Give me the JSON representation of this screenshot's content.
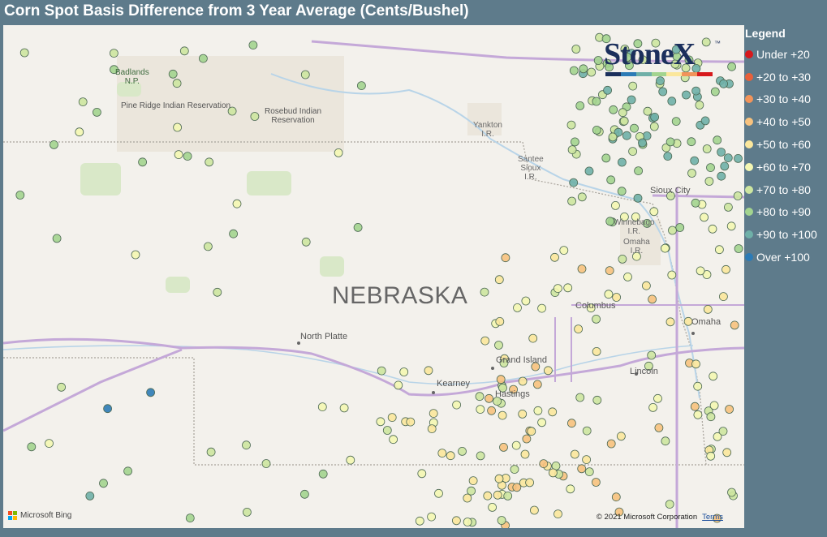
{
  "title": "Corn Spot Basis Difference from 3 Year Average (Cents/Bushel)",
  "legend": {
    "title": "Legend",
    "items": [
      {
        "label": "Under +20",
        "color": "#d7191c"
      },
      {
        "label": "+20 to +30",
        "color": "#e8603a"
      },
      {
        "label": "+30 to +40",
        "color": "#f2945a"
      },
      {
        "label": "+40 to +50",
        "color": "#f7c27e"
      },
      {
        "label": "+50 to +60",
        "color": "#fbe79c"
      },
      {
        "label": "+60 to +70",
        "color": "#f4f7b3"
      },
      {
        "label": "+70 to +80",
        "color": "#cde6a0"
      },
      {
        "label": "+80 to +90",
        "color": "#a3d48f"
      },
      {
        "label": "+90 to +100",
        "color": "#6fb0a8"
      },
      {
        "label": "Over +100",
        "color": "#2c7bb6"
      }
    ]
  },
  "map": {
    "state_label": "NEBRASKA",
    "places": [
      {
        "name": "Badlands\nN.P.",
        "kind": "park"
      },
      {
        "name": "Pine Ridge Indian Reservation",
        "kind": "park"
      },
      {
        "name": "Rosebud Indian\nReservation",
        "kind": "park"
      },
      {
        "name": "Yankton\nI.R.",
        "kind": "small"
      },
      {
        "name": "Santee\nSioux\nI.R.",
        "kind": "small"
      },
      {
        "name": "Sioux City",
        "kind": "city"
      },
      {
        "name": "Winnebago\nI.R.",
        "kind": "small"
      },
      {
        "name": "Omaha\nI.R.",
        "kind": "small"
      },
      {
        "name": "North Platte",
        "kind": "city"
      },
      {
        "name": "Columbus",
        "kind": "city"
      },
      {
        "name": "Omaha",
        "kind": "city"
      },
      {
        "name": "Grand Island",
        "kind": "city"
      },
      {
        "name": "Kearney",
        "kind": "city"
      },
      {
        "name": "Hastings",
        "kind": "city"
      },
      {
        "name": "Lincoln",
        "kind": "city"
      }
    ]
  },
  "logo": {
    "text": "StoneX",
    "trademark": "™",
    "bar_colors": [
      "#1b2f5c",
      "#2c7bb6",
      "#6fb0a8",
      "#a3d48f",
      "#fbe79c",
      "#f2945a",
      "#d7191c"
    ]
  },
  "attribution": {
    "copyright": "© 2021 Microsoft Corporation",
    "terms": "Terms",
    "provider": "Microsoft Bing",
    "provider_colors": [
      "#f25022",
      "#7fba00",
      "#00a4ef",
      "#ffb900"
    ]
  }
}
